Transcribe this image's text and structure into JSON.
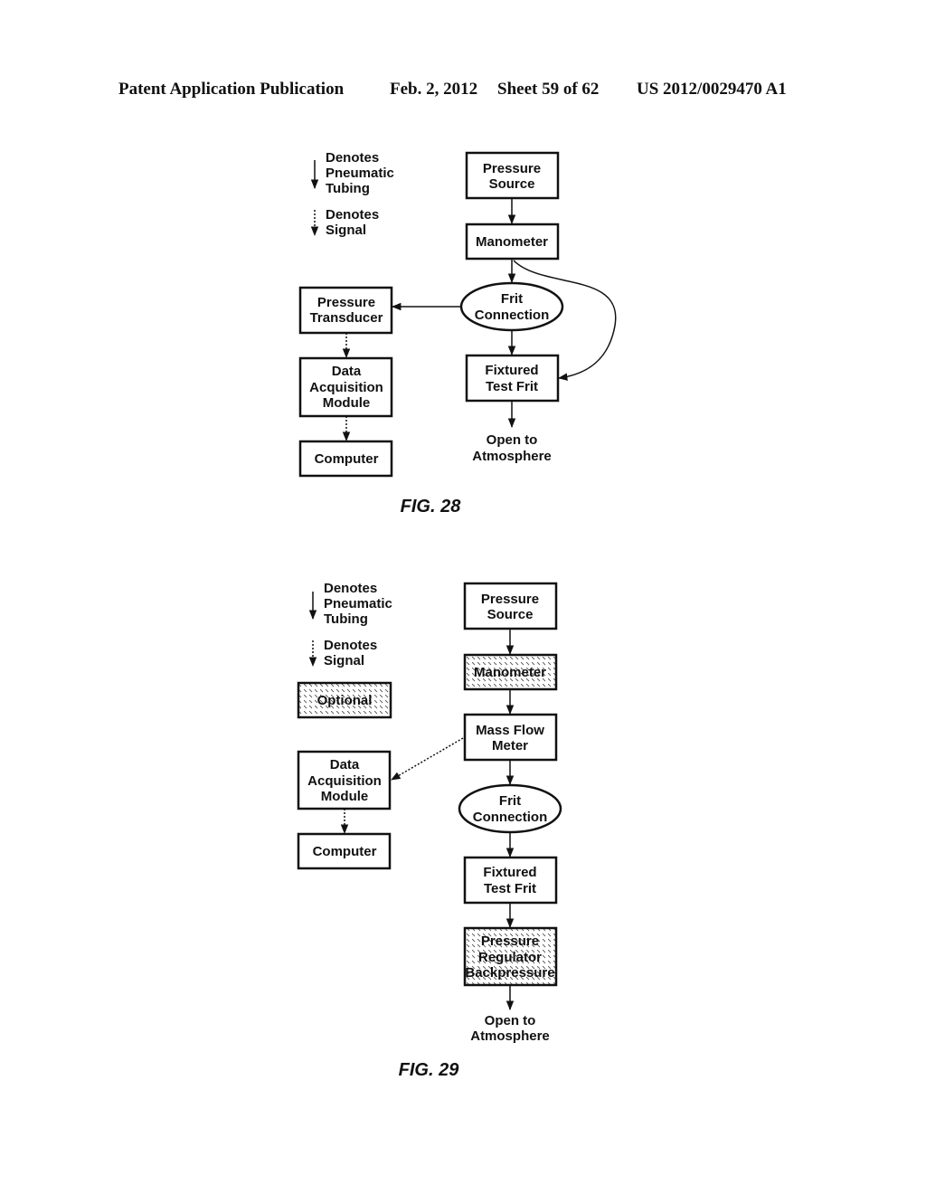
{
  "header": {
    "publication": "Patent Application Publication",
    "date": "Feb. 2, 2012",
    "sheet": "Sheet 59 of 62",
    "patent_number": "US 2012/0029470 A1"
  },
  "fig28": {
    "legend": {
      "pneumatic": [
        "Denotes",
        "Pneumatic",
        "Tubing"
      ],
      "signal": [
        "Denotes",
        "Signal"
      ]
    },
    "nodes": {
      "pressure_source": [
        "Pressure",
        "Source"
      ],
      "manometer": [
        "Manometer"
      ],
      "frit_connection": [
        "Frit",
        "Connection"
      ],
      "pressure_transducer": [
        "Pressure",
        "Transducer"
      ],
      "data_acquisition": [
        "Data",
        "Acquisition",
        "Module"
      ],
      "computer": [
        "Computer"
      ],
      "fixtured_test_frit": [
        "Fixtured",
        "Test Frit"
      ],
      "open_atmosphere": [
        "Open to",
        "Atmosphere"
      ]
    },
    "caption": "FIG. 28"
  },
  "fig29": {
    "legend": {
      "pneumatic": [
        "Denotes",
        "Pneumatic",
        "Tubing"
      ],
      "signal": [
        "Denotes",
        "Signal"
      ],
      "optional": "Optional"
    },
    "nodes": {
      "pressure_source": [
        "Pressure",
        "Source"
      ],
      "manometer": [
        "Manometer"
      ],
      "mass_flow_meter": [
        "Mass Flow",
        "Meter"
      ],
      "frit_connection": [
        "Frit",
        "Connection"
      ],
      "fixtured_test_frit": [
        "Fixtured",
        "Test Frit"
      ],
      "pressure_regulator": [
        "Pressure",
        "Regulator",
        "Backpressure"
      ],
      "data_acquisition": [
        "Data",
        "Acquisition",
        "Module"
      ],
      "computer": [
        "Computer"
      ],
      "open_atmosphere": [
        "Open to",
        "Atmosphere"
      ]
    },
    "caption": "FIG. 29"
  }
}
